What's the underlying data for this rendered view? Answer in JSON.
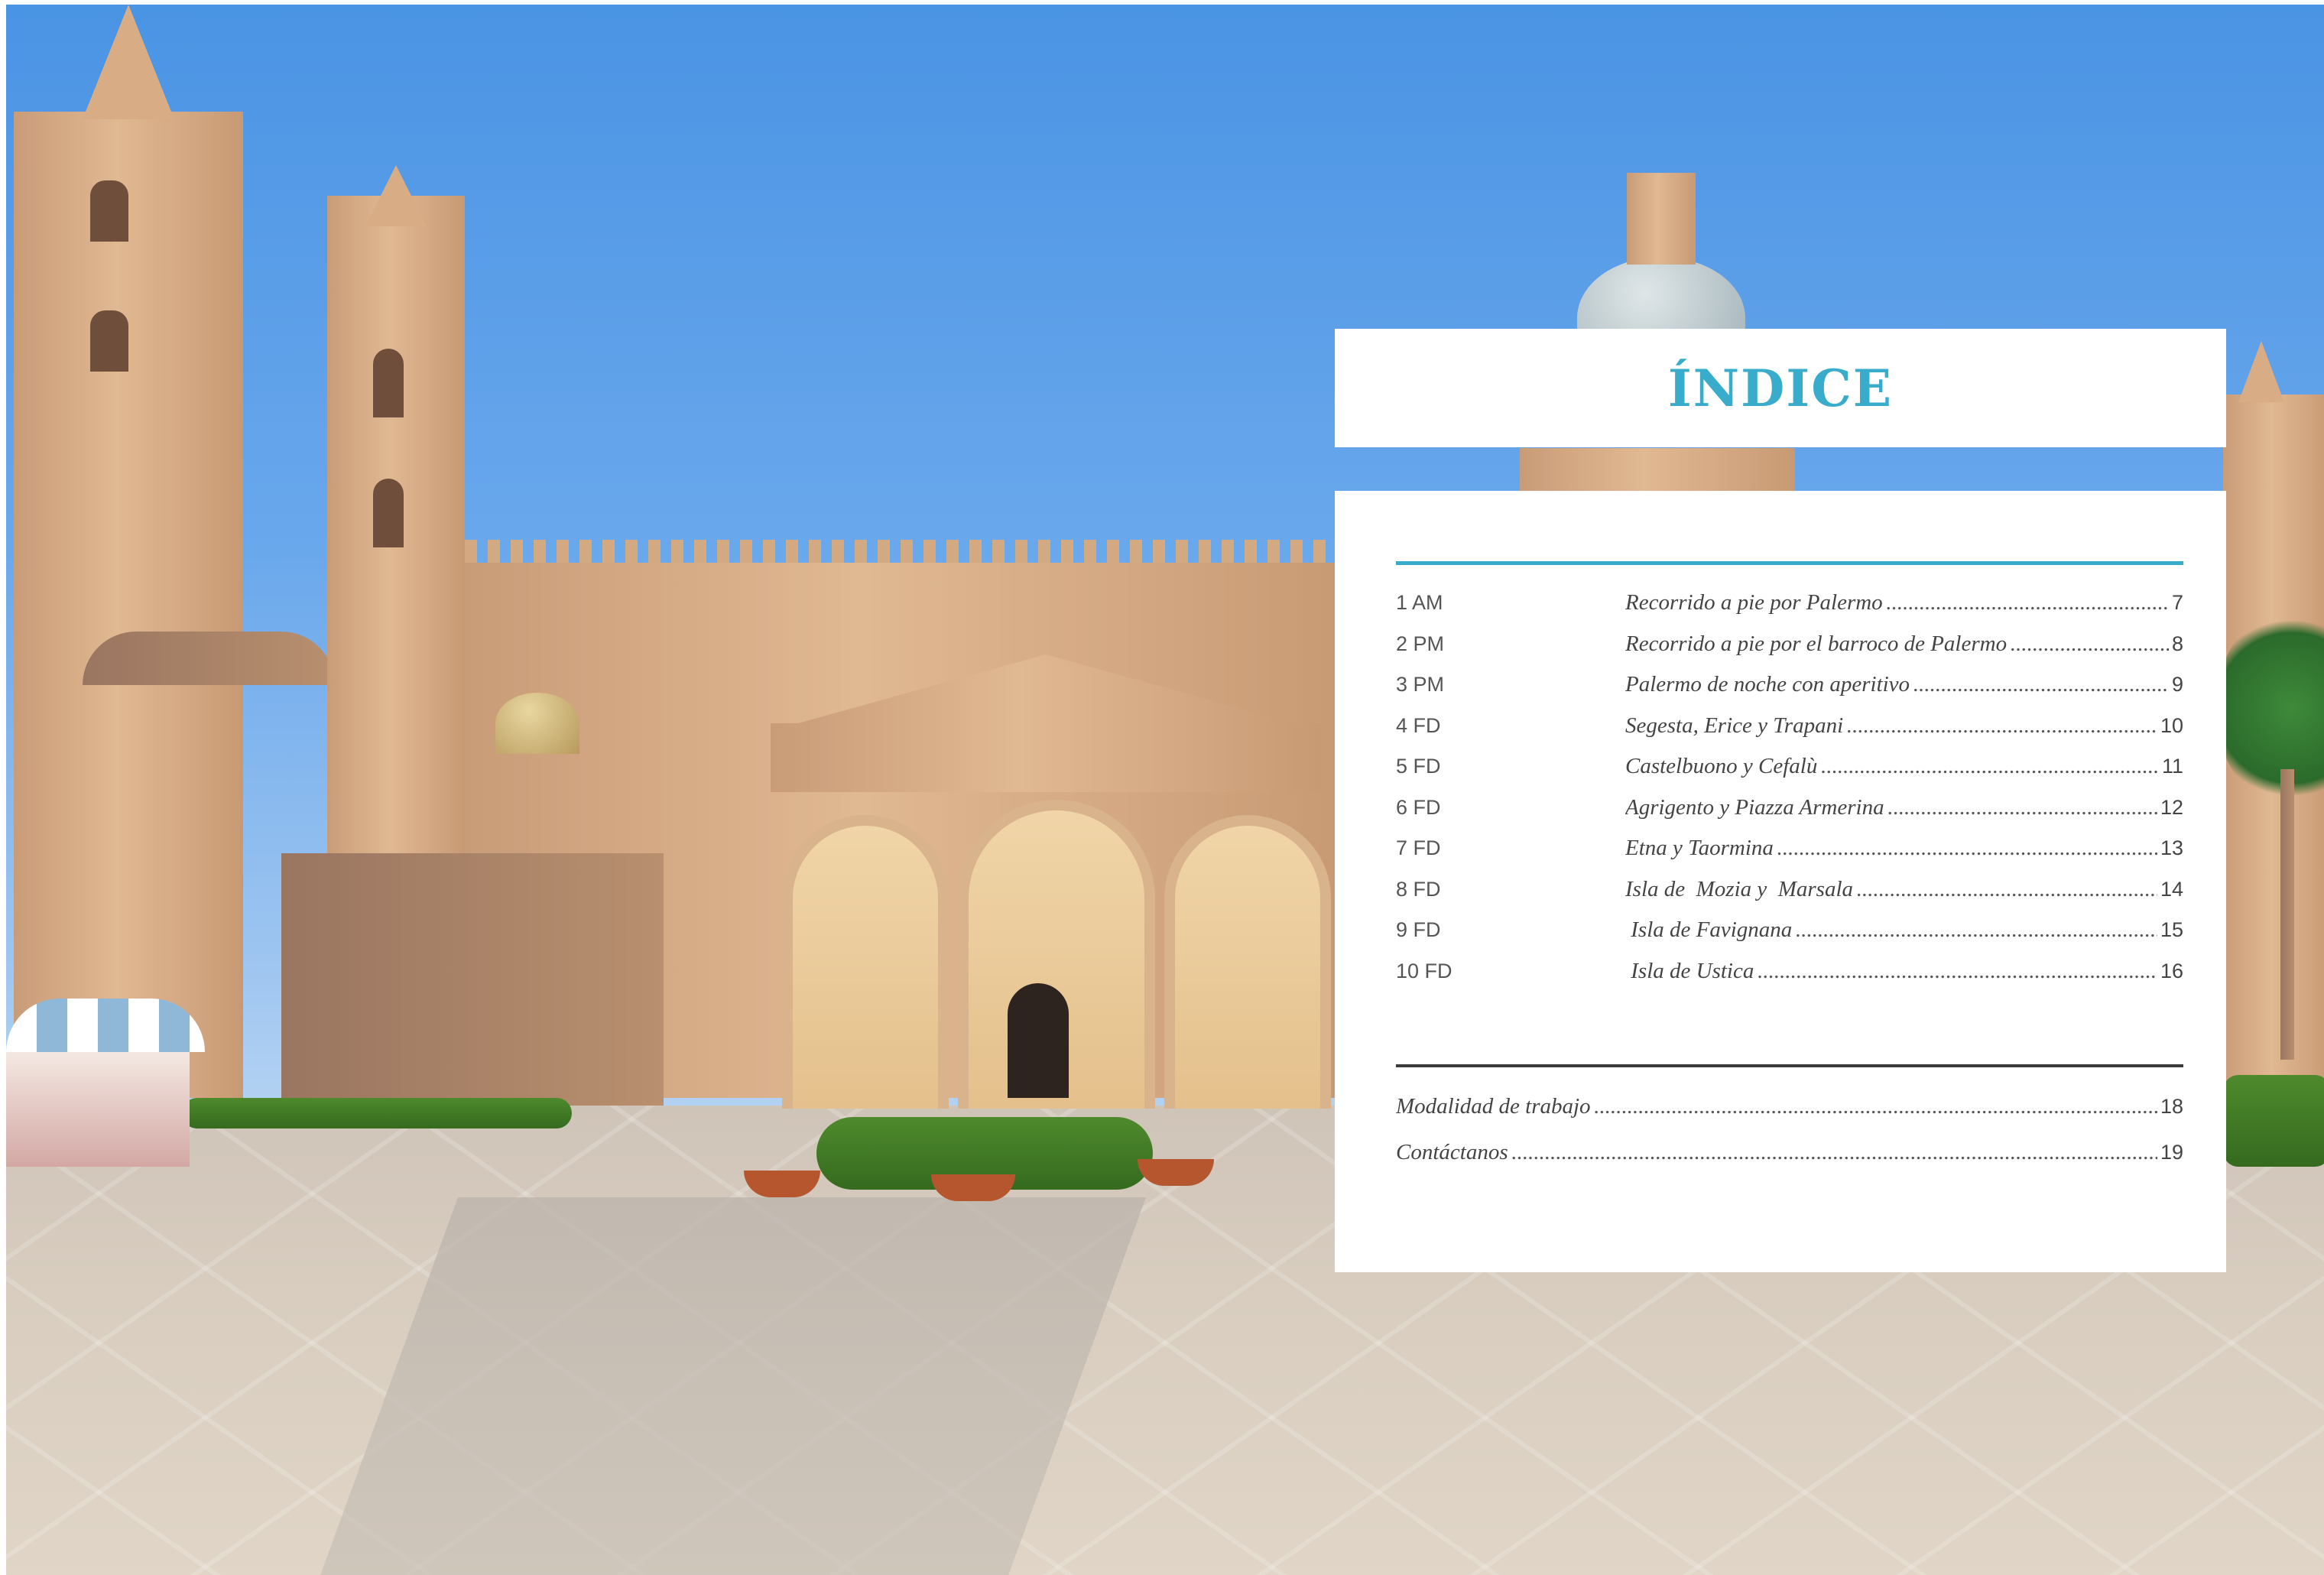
{
  "index": {
    "title": "ÍNDICE",
    "items": [
      {
        "code": "1 AM",
        "label": "Recorrido a pie por Palermo",
        "page": "7"
      },
      {
        "code": "2 PM",
        "label": "Recorrido a pie por el barroco de Palermo",
        "page": "8"
      },
      {
        "code": "3 PM",
        "label": "Palermo de noche con aperitivo",
        "page": "9"
      },
      {
        "code": "4 FD",
        "label": "Segesta, Erice y Trapani",
        "page": "10"
      },
      {
        "code": "5 FD",
        "label": "Castelbuono y Cefalù",
        "page": "11"
      },
      {
        "code": "6 FD",
        "label": "Agrigento y Piazza Armerina",
        "page": "12"
      },
      {
        "code": "7 FD",
        "label": "Etna y Taormina",
        "page": "13"
      },
      {
        "code": "8 FD",
        "label": "Isla de  Mozia y  Marsala",
        "page": "14"
      },
      {
        "code": "9 FD",
        "label": " Isla de Favignana",
        "page": "15"
      },
      {
        "code": "10 FD",
        "label": " Isla de Ustica",
        "page": "16"
      }
    ],
    "extras": [
      {
        "label": "Modalidad de trabajo",
        "page": "18"
      },
      {
        "label": "Contáctanos",
        "page": "19"
      }
    ]
  },
  "colors": {
    "accent": "#3aaccb",
    "rule_dark": "#3a3a3a",
    "text": "#444444"
  }
}
